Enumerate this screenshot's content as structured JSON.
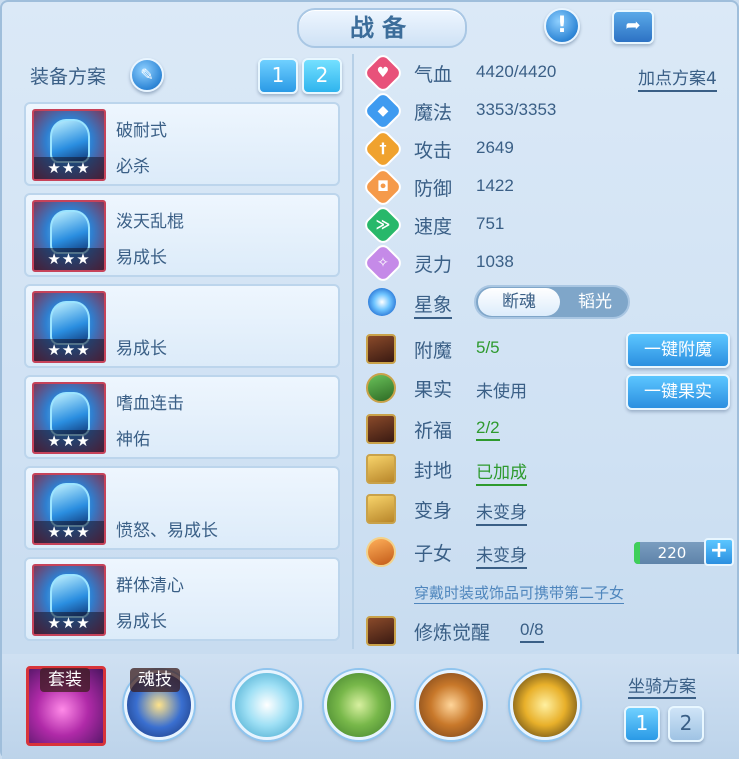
{
  "title": "战备",
  "header": {
    "info_icon": "exclamation-icon",
    "share_icon": "share-icon"
  },
  "left": {
    "heading": "装备方案",
    "pages": [
      "1",
      "2"
    ],
    "equipment": [
      {
        "name": "破耐式",
        "sub": "必杀",
        "stars": "★★★"
      },
      {
        "name": "泼天乱棍",
        "sub": "易成长",
        "stars": "★★★"
      },
      {
        "name": "",
        "sub": "易成长",
        "stars": "★★★"
      },
      {
        "name": "嗜血连击",
        "sub": "神佑",
        "stars": "★★★"
      },
      {
        "name": "",
        "sub": "愤怒、易成长",
        "stars": "★★★"
      },
      {
        "name": "群体清心",
        "sub": "易成长",
        "stars": "★★★"
      }
    ]
  },
  "stats": [
    {
      "label": "气血",
      "value": "4420/4420",
      "color": "#e8527a",
      "glyph": "♥"
    },
    {
      "label": "魔法",
      "value": "3353/3353",
      "color": "#3f9bf0",
      "glyph": "◆"
    },
    {
      "label": "攻击",
      "value": "2649",
      "color": "#f0a22e",
      "glyph": "†"
    },
    {
      "label": "防御",
      "value": "1422",
      "color": "#f59a4a",
      "glyph": "◘"
    },
    {
      "label": "速度",
      "value": "751",
      "color": "#28b86a",
      "glyph": "≫"
    },
    {
      "label": "灵力",
      "value": "1038",
      "color": "#c58ae8",
      "glyph": "✧"
    }
  ],
  "add_point_plan": "加点方案4",
  "star_sign": {
    "label": "星象",
    "options": [
      "断魂",
      "韬光"
    ]
  },
  "attrs": [
    {
      "label": "附魔",
      "value": "5/5"
    },
    {
      "label": "果实",
      "value": "未使用"
    },
    {
      "label": "祈福",
      "value": "2/2"
    },
    {
      "label": "封地",
      "value": "已加成"
    },
    {
      "label": "变身",
      "value": "未变身"
    },
    {
      "label": "子女",
      "value": "未变身"
    }
  ],
  "buttons": {
    "one_click_enchant": "一键附魔",
    "one_click_fruit": "一键果实"
  },
  "child_value": "220",
  "hint": "穿戴时装或饰品可携带第二子女",
  "cultivation": {
    "label": "修炼觉醒",
    "value": "0/8"
  },
  "bottom": {
    "suit_tag": "套装",
    "soul_tag": "魂技",
    "mount_label": "坐骑方案",
    "mount_pages": [
      "1",
      "2"
    ]
  }
}
